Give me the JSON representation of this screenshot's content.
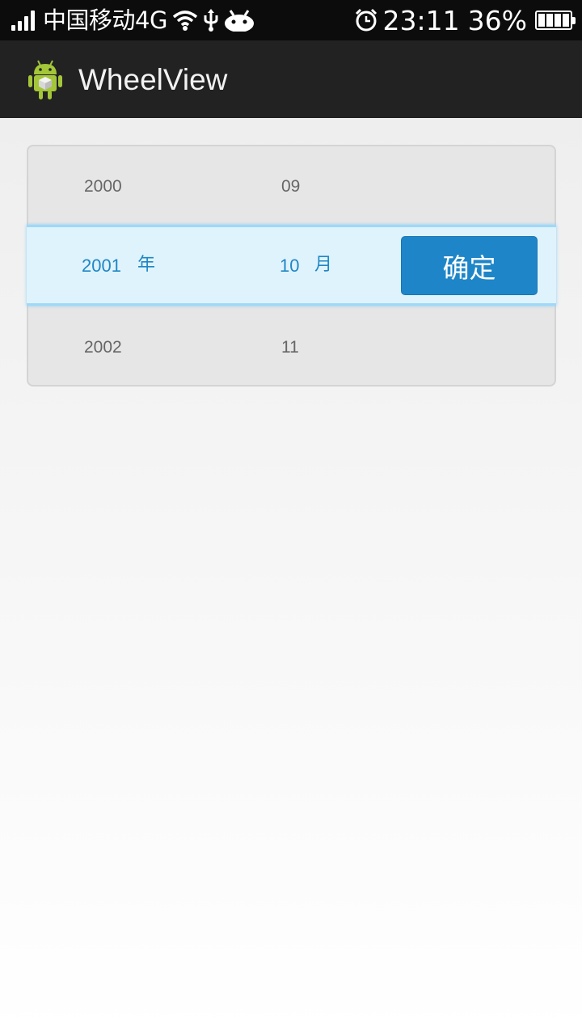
{
  "status_bar": {
    "carrier": "中国移动4G",
    "time": "23:11",
    "battery": "36%",
    "icons": [
      "signal-icon",
      "wifi-icon",
      "usb-icon",
      "android-notification-icon",
      "alarm-icon",
      "battery-icon"
    ]
  },
  "action_bar": {
    "title": "WheelView",
    "icon": "android-app-icon"
  },
  "wheel": {
    "above": {
      "year": "2000",
      "month": "09"
    },
    "selected": {
      "year": "2001",
      "year_unit": "年",
      "month": "10",
      "month_unit": "月"
    },
    "below": {
      "year": "2002",
      "month": "11"
    },
    "confirm_label": "确定"
  },
  "colors": {
    "accent": "#1e86c8",
    "selected_text": "#1f87c4",
    "selection_band": "#dff3fd",
    "action_bar": "#222222",
    "status_bar": "#0c0c0c"
  }
}
